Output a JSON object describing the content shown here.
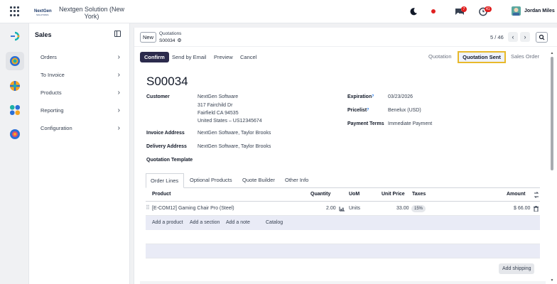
{
  "topbar": {
    "company": "Nextgen Solution (New York)",
    "logo_text": "NextGen SOLUTIONS",
    "messages_badge": "7",
    "activity_badge": "41",
    "user_name": "Jordan Miles",
    "icons": [
      "apps-grid-icon",
      "moon-icon",
      "status-dot-icon",
      "chat-icon",
      "clock-icon"
    ]
  },
  "rail": {
    "items": [
      "sales-app-icon",
      "discuss-app-icon",
      "crm-app-icon",
      "inventory-app-icon",
      "settings-app-icon"
    ]
  },
  "sidebar": {
    "title": "Sales",
    "items": [
      {
        "label": "Orders"
      },
      {
        "label": "To Invoice"
      },
      {
        "label": "Products"
      },
      {
        "label": "Reporting"
      },
      {
        "label": "Configuration"
      }
    ]
  },
  "control": {
    "new_label": "New",
    "breadcrumb_parent": "Quotations",
    "breadcrumb_current": "S00034",
    "pager": "5 / 46"
  },
  "actions": {
    "confirm": "Confirm",
    "send_email": "Send by Email",
    "preview": "Preview",
    "cancel": "Cancel"
  },
  "stages": {
    "quotation": "Quotation",
    "quotation_sent": "Quotation Sent",
    "sales_order": "Sales Order"
  },
  "record": {
    "name": "S00034",
    "customer_label": "Customer",
    "customer_name": "NextGen Software",
    "customer_addr1": "317 Fairchild Dr",
    "customer_addr2": "Fairfield CA 94535",
    "customer_addr3": "United States – US12345674",
    "invoice_address_label": "Invoice Address",
    "invoice_address": "NextGen Software, Taylor Brooks",
    "delivery_address_label": "Delivery Address",
    "delivery_address": "NextGen Software, Taylor Brooks",
    "template_label": "Quotation Template",
    "expiration_label": "Expiration",
    "expiration": "03/23/2026",
    "pricelist_label": "Pricelist",
    "pricelist": "Benelux (USD)",
    "payment_terms_label": "Payment Terms",
    "payment_terms": "Immediate Payment",
    "help_mark": "?"
  },
  "tabs": [
    "Order Lines",
    "Optional Products",
    "Quote Builder",
    "Other Info"
  ],
  "table": {
    "headers": {
      "product": "Product",
      "quantity": "Quantity",
      "uom": "UoM",
      "unit_price": "Unit Price",
      "taxes": "Taxes",
      "amount": "Amount"
    },
    "rows": [
      {
        "product": "[E-COM12] Gaming Chair Pro (Steel)",
        "quantity": "2.00",
        "uom": "Units",
        "unit_price": "33.00",
        "tax": "15%",
        "amount": "$ 66.00"
      }
    ],
    "add_links": [
      "Add a product",
      "Add a section",
      "Add a note",
      "Catalog"
    ]
  },
  "footer": {
    "add_shipping": "Add shipping"
  },
  "colors": {
    "primary": "#2b2a4c",
    "stage_highlight": "#e8b92b",
    "badge": "#e02020",
    "row_tint": "#e9ebf6"
  }
}
